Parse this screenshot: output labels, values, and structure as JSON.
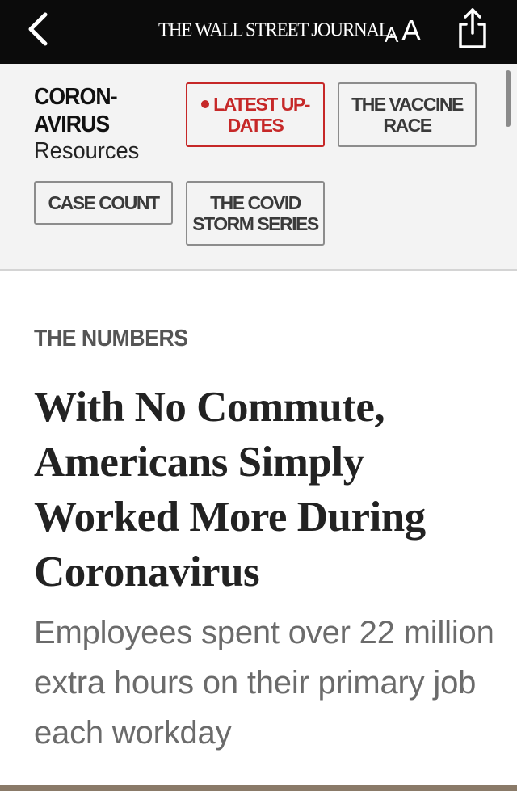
{
  "topbar": {
    "masthead": "THE WALL STREET JOURNAL.",
    "font_size_small": "A",
    "font_size_large": "A",
    "icons": {
      "back": "chevron-left-icon",
      "share": "share-icon"
    }
  },
  "resources": {
    "title": "CORON-AVIRUS",
    "title_line1": "CORON-",
    "title_line2": "AVIRUS",
    "subtitle": "Resources",
    "buttons": {
      "latest_line1": "LATEST UP-",
      "latest_line2": "DATES",
      "vaccine_line1": "THE VACCINE",
      "vaccine_line2": "RACE",
      "case_count": "CASE COUNT",
      "storm_line1": "THE COVID",
      "storm_line2": "STORM SERIES"
    }
  },
  "article": {
    "kicker": "THE NUMBERS",
    "headline": "With No Commute, Americans Simply Worked More During Coronavirus",
    "dek": "Employees spent over 22 million extra hours on their primary job each workday"
  },
  "colors": {
    "accent_red": "#c62828",
    "topbar": "#0b0b0b",
    "panel": "#f3f3f3"
  }
}
